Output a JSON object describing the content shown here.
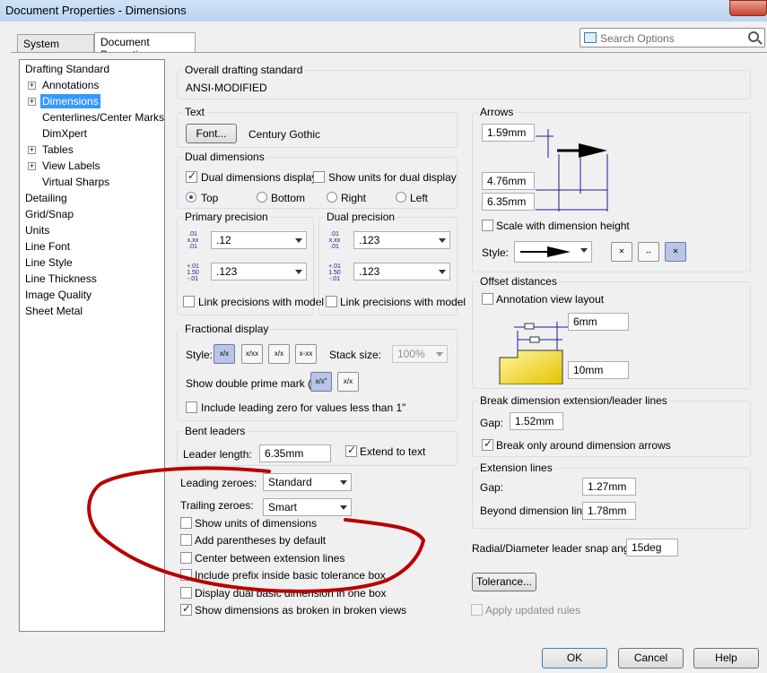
{
  "window": {
    "title": "Document Properties - Dimensions"
  },
  "tabs": [
    "System Options",
    "Document Properties"
  ],
  "search": {
    "placeholder": "Search Options"
  },
  "tree": [
    "Drafting Standard",
    "Annotations",
    "Dimensions",
    "Centerlines/Center Marks",
    "DimXpert",
    "Tables",
    "View Labels",
    "Virtual Sharps",
    "Detailing",
    "Grid/Snap",
    "Units",
    "Line Font",
    "Line Style",
    "Line Thickness",
    "Image Quality",
    "Sheet Metal"
  ],
  "overall": {
    "title": "Overall drafting standard",
    "value": "ANSI-MODIFIED"
  },
  "text": {
    "title": "Text",
    "font_button": "Font...",
    "font_name": "Century Gothic"
  },
  "dual": {
    "title": "Dual dimensions",
    "display": "Dual dimensions display",
    "show_units": "Show units for dual display",
    "top": "Top",
    "bottom": "Bottom",
    "right": "Right",
    "left": "Left"
  },
  "primary": {
    "title": "Primary precision",
    "v1": ".12",
    "v2": ".123",
    "link": "Link precisions with model"
  },
  "dualprec": {
    "title": "Dual precision",
    "v1": ".123",
    "v2": ".123",
    "link": "Link precisions with model"
  },
  "prec_icons": {
    "a_top": ".01",
    "a_mid": "x.xx",
    "a_bot": ".01",
    "b_top": "+.01",
    "b_mid": "1.50",
    "b_bot": "-.01"
  },
  "fractional": {
    "title": "Fractional display",
    "style": "Style:",
    "stack_label": "Stack size:",
    "stack_value": "100%",
    "double_prime": "Show double prime mark (\"):",
    "leading_zero": "Include leading zero for values less than 1\"",
    "icons": [
      "x/x",
      "x/xx",
      "x/x",
      "x-xx",
      "x/x\"",
      "x/x"
    ]
  },
  "bent": {
    "title": "Bent leaders",
    "leader_label": "Leader length:",
    "leader_value": "6.35mm",
    "extend": "Extend to text"
  },
  "zeroes": {
    "leading_label": "Leading zeroes:",
    "leading_value": "Standard",
    "trailing_label": "Trailing zeroes:",
    "trailing_value": "Smart"
  },
  "opts": [
    "Show units of dimensions",
    "Add parentheses by default",
    "Center between extension lines",
    "Include prefix inside basic tolerance box",
    "Display dual basic dimension in one box",
    "Show dimensions as broken in broken views"
  ],
  "arrows": {
    "title": "Arrows",
    "v1": "1.59mm",
    "v2": "4.76mm",
    "v3": "6.35mm",
    "scale": "Scale with dimension height",
    "style": "Style:"
  },
  "offset": {
    "title": "Offset distances",
    "annotation": "Annotation view layout",
    "v1": "6mm",
    "v2": "10mm"
  },
  "break": {
    "title": "Break dimension extension/leader lines",
    "gap_label": "Gap:",
    "gap_value": "1.52mm",
    "only": "Break only around dimension arrows"
  },
  "extension": {
    "title": "Extension lines",
    "gap_label": "Gap:",
    "gap_value": "1.27mm",
    "beyond_label": "Beyond dimension line:",
    "beyond_value": "1.78mm"
  },
  "radial": {
    "label": "Radial/Diameter leader snap angle:",
    "value": "15deg"
  },
  "tolerance": "Tolerance...",
  "apply": "Apply updated rules",
  "buttons": {
    "ok": "OK",
    "cancel": "Cancel",
    "help": "Help"
  },
  "colors": {
    "annotation": "#b80000",
    "selection": "#3399ff",
    "part_fill": "#f1d900"
  }
}
